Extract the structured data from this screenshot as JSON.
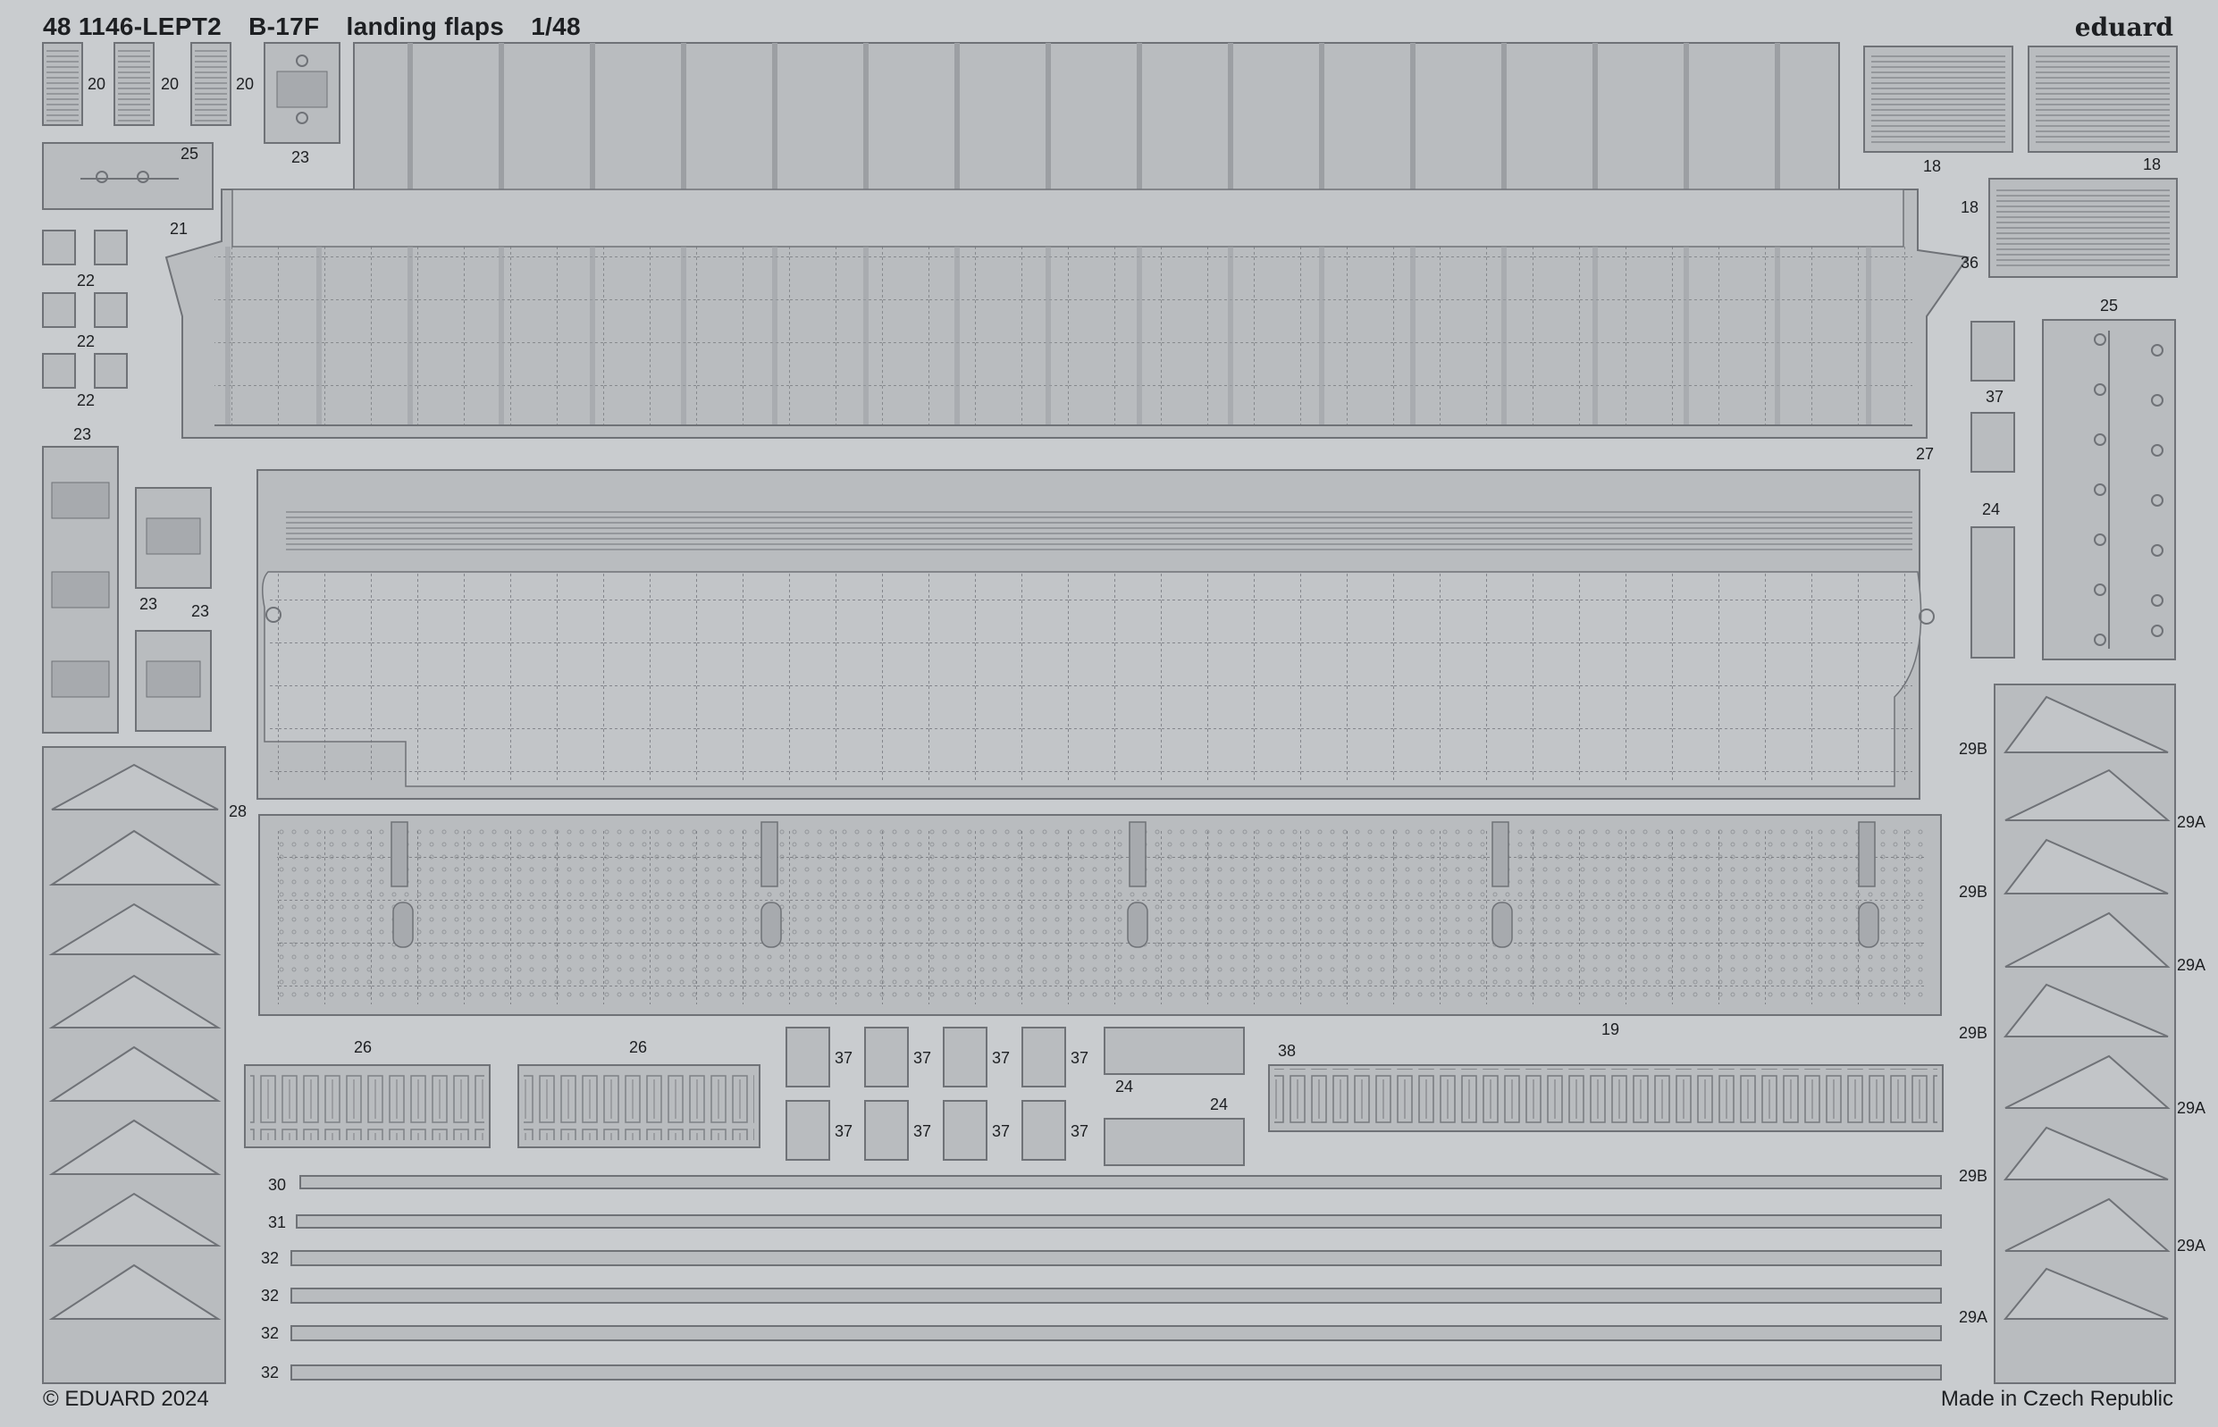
{
  "title": {
    "code": "48 1146-LEPT2",
    "aircraft": "B-17F",
    "subject": "landing flaps",
    "scale": "1/48"
  },
  "brand": "eduard",
  "footer": {
    "copyright": "© EDUARD 2024",
    "origin": "Made in Czech Republic"
  },
  "labels": {
    "p20a": "20",
    "p20b": "20",
    "p20c": "20",
    "p23a": "23",
    "p23b": "23",
    "p23c": "23",
    "p23d": "23",
    "p25a": "25",
    "p25b": "25",
    "p21": "21",
    "p22a": "22",
    "p22b": "22",
    "p22c": "22",
    "p18a": "18",
    "p18b": "18",
    "p18c": "18",
    "p36": "36",
    "p37a": "37",
    "p24a": "24",
    "p24b": "24",
    "p24c": "24",
    "p27": "27",
    "p28": "28",
    "p29B_1": "29B",
    "p29B_2": "29B",
    "p29B_3": "29B",
    "p29B_4": "29B",
    "p29A_1": "29A",
    "p29A_2": "29A",
    "p29A_3": "29A",
    "p29A_4": "29A",
    "p29A_5": "29A",
    "p19": "19",
    "p26a": "26",
    "p26b": "26",
    "p37_1": "37",
    "p37_2": "37",
    "p37_3": "37",
    "p37_4": "37",
    "p37_5": "37",
    "p37_6": "37",
    "p37_7": "37",
    "p37_8": "37",
    "p38": "38",
    "p30": "30",
    "p31": "31",
    "p32a": "32",
    "p32b": "32",
    "p32c": "32",
    "p32d": "32"
  },
  "colors": {
    "fret": "#c9cccf",
    "part": "#b9bcbf",
    "part_dark": "#a7aaae",
    "line": "#6f7277",
    "text": "#1d1f22"
  }
}
